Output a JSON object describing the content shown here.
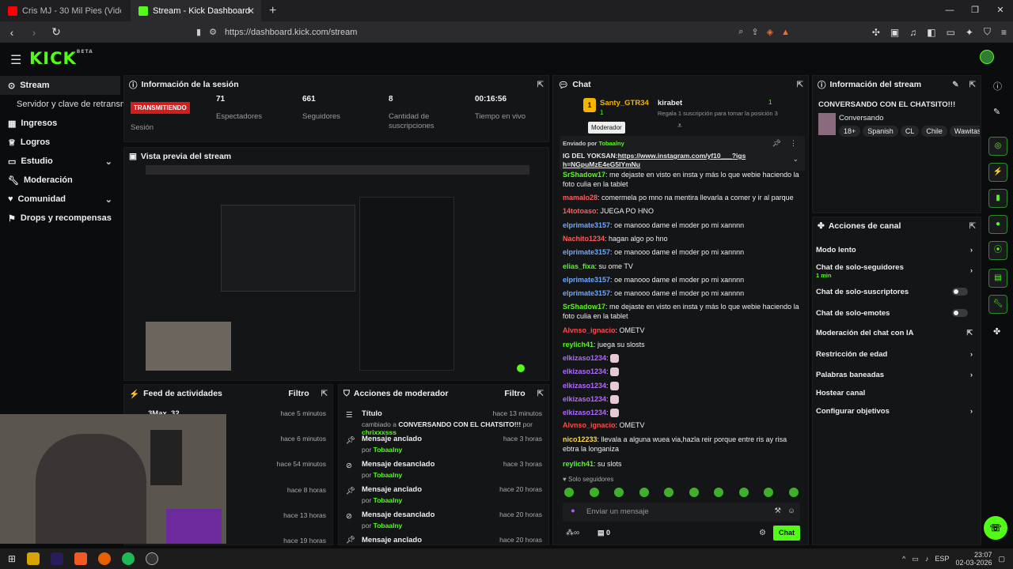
{
  "browser": {
    "tabs": [
      {
        "label": "Cris MJ - 30 Mil Pies (Video Ofici"
      },
      {
        "label": "Stream - Kick Dashboard"
      }
    ],
    "url": "https://dashboard.kick.com/stream"
  },
  "site": {
    "logo": "KICK",
    "logo_badge": "BETA"
  },
  "sidebar": {
    "items": [
      {
        "label": "Stream"
      },
      {
        "label": "Servidor y clave de retransm"
      },
      {
        "label": "Ingresos"
      },
      {
        "label": "Logros"
      },
      {
        "label": "Estudio"
      },
      {
        "label": "Moderación"
      },
      {
        "label": "Comunidad"
      },
      {
        "label": "Drops y recompensas"
      }
    ]
  },
  "session": {
    "title": "Información de la sesión",
    "badge": "TRANSMITIENDO",
    "badge_label": "Sesión",
    "stats": [
      {
        "value": "71",
        "label": "Espectadores"
      },
      {
        "value": "661",
        "label": "Seguidores"
      },
      {
        "value": "8",
        "label": "Cantidad de suscripciones"
      },
      {
        "value": "00:16:56",
        "label": "Tiempo en vivo"
      }
    ]
  },
  "preview": {
    "title": "Vista previa del stream"
  },
  "feed": {
    "title": "Feed de actividades",
    "filter": "Filtro",
    "items": [
      {
        "name": "3Max_32",
        "ago": "hace 5 minutos"
      },
      {
        "name": "",
        "ago": "hace 6 minutos"
      },
      {
        "name": "",
        "ago": "hace 54 minutos"
      },
      {
        "name": "",
        "ago": "hace 8 horas"
      },
      {
        "name": "",
        "ago": "hace 13 horas"
      },
      {
        "name": "",
        "ago": "hace 19 horas"
      }
    ]
  },
  "modactions": {
    "title": "Acciones de moderador",
    "filter": "Filtro",
    "items": [
      {
        "title": "Título",
        "prefix": "cambiado a",
        "value": "CONVERSANDO CON EL CHATSITO!!!",
        "by_label": "por",
        "by": "chrixxxsss",
        "ago": "hace 13 minutos"
      },
      {
        "title": "Mensaje anclado",
        "by_label": "por",
        "by": "Tobaalny",
        "ago": "hace 3 horas"
      },
      {
        "title": "Mensaje desanclado",
        "by_label": "por",
        "by": "Tobaalny",
        "ago": "hace 3 horas"
      },
      {
        "title": "Mensaje anclado",
        "by_label": "por",
        "by": "Tobaalny",
        "ago": "hace 20 horas"
      },
      {
        "title": "Mensaje desanclado",
        "by_label": "por",
        "by": "Tobaalny",
        "ago": "hace 20 horas"
      },
      {
        "title": "Mensaje anclado",
        "by_label": "",
        "by": "",
        "ago": "hace 20 horas"
      }
    ]
  },
  "chat": {
    "title": "Chat",
    "top_gifter": {
      "rank": "1",
      "name": "Santy_GTR34",
      "count": "1",
      "other": "kirabet",
      "other_count": "1",
      "cta": "Regala 1 suscripción para tomar la posición 3"
    },
    "tooltip": "Moderador",
    "pinned": {
      "by_label": "Enviado por",
      "by": "Tobaalny",
      "text": "IG DEL YOKSAN:",
      "link": "https://www.instagram.com/yf10___?igsh=NGpuMzE4eG5IYmNu"
    },
    "messages": [
      {
        "user": "SrShadow17",
        "text": "me dejaste en visto en insta y más lo que webie haciendo la foto culia en la tablet",
        "color": "#53fc18"
      },
      {
        "user": "mamalo28",
        "text": "comermela po mno na mentira llevarla a comer y ir al parque",
        "color": "#ff5e5e"
      },
      {
        "user": "14totoaso",
        "text": "JUEGA PO HNO",
        "color": "#ff5e5e"
      },
      {
        "user": "elprimate3157",
        "text": "oe manooo dame el moder po mi xannnn",
        "color": "#6fa8ff"
      },
      {
        "user": "Nachito1234",
        "text": "hagan algo po hno",
        "color": "#ff5e5e"
      },
      {
        "user": "elprimate3157",
        "text": "oe manooo dame el moder po mi xannnn",
        "color": "#6fa8ff"
      },
      {
        "user": "elias_fixa",
        "text": "su ome TV",
        "color": "#53fc18"
      },
      {
        "user": "elprimate3157",
        "text": "oe manooo dame el moder po mi xannnn",
        "color": "#6fa8ff"
      },
      {
        "user": "elprimate3157",
        "text": "oe manooo dame el moder po mi xannnn",
        "color": "#6fa8ff"
      },
      {
        "user": "SrShadow17",
        "text": "me dejaste en visto en insta y más lo que webie haciendo la foto culia en la tablet",
        "color": "#53fc18"
      },
      {
        "user": "Alvnso_ignacio",
        "text": "OMETV",
        "color": "#ff4b4b"
      },
      {
        "user": "reylich41",
        "text": "juega su slosts",
        "color": "#53fc18"
      },
      {
        "user": "elkizaso1234",
        "text": "",
        "color": "#b36bff"
      },
      {
        "user": "elkizaso1234",
        "text": "",
        "color": "#b36bff"
      },
      {
        "user": "elkizaso1234",
        "text": "",
        "color": "#b36bff"
      },
      {
        "user": "elkizaso1234",
        "text": "",
        "color": "#b36bff"
      },
      {
        "user": "elkizaso1234",
        "text": "",
        "color": "#b36bff"
      },
      {
        "user": "Alvnso_ignacio",
        "text": "OMETV",
        "color": "#ff4b4b"
      },
      {
        "user": "nico12233",
        "text": "llevala a alguna wuea via,hazla reir porque entre ris ay risa ebtra la longaniza",
        "color": "#ffd84a"
      },
      {
        "user": "reylich41",
        "text": "su slots",
        "color": "#53fc18"
      }
    ],
    "followers_only": "Solo seguidores",
    "placeholder": "Enviar un mensaje",
    "points": "0",
    "send": "Chat"
  },
  "stream_info": {
    "title": "Información del stream",
    "stream_title": "CONVERSANDO CON EL CHATSITO!!!",
    "category": "Conversando",
    "tags": [
      "18+",
      "Spanish",
      "CL",
      "Chile",
      "Wawitas"
    ]
  },
  "channel_actions": {
    "title": "Acciones de canal",
    "items": [
      {
        "label": "Modo lento",
        "sub": "",
        "kind": "chevron"
      },
      {
        "label": "Chat de solo-seguidores",
        "sub": "1 min",
        "kind": "chevron"
      },
      {
        "label": "Chat de solo-suscriptores",
        "sub": "",
        "kind": "toggle"
      },
      {
        "label": "Chat de solo-emotes",
        "sub": "",
        "kind": "toggle"
      },
      {
        "label": "Moderación del chat con IA",
        "sub": "",
        "kind": "external"
      },
      {
        "label": "Restricción de edad",
        "sub": "",
        "kind": "chevron"
      },
      {
        "label": "Palabras baneadas",
        "sub": "",
        "kind": "chevron"
      },
      {
        "label": "Hostear canal",
        "sub": "",
        "kind": "none"
      },
      {
        "label": "Configurar objetivos",
        "sub": "",
        "kind": "chevron"
      }
    ]
  },
  "taskbar": {
    "time": "23:07",
    "date": "02-03-2026",
    "lang": "ESP"
  },
  "colors": {
    "accent": "#53fc18",
    "live": "#d21d1d",
    "panel": "#141517",
    "bg": "#0b0c0d"
  }
}
